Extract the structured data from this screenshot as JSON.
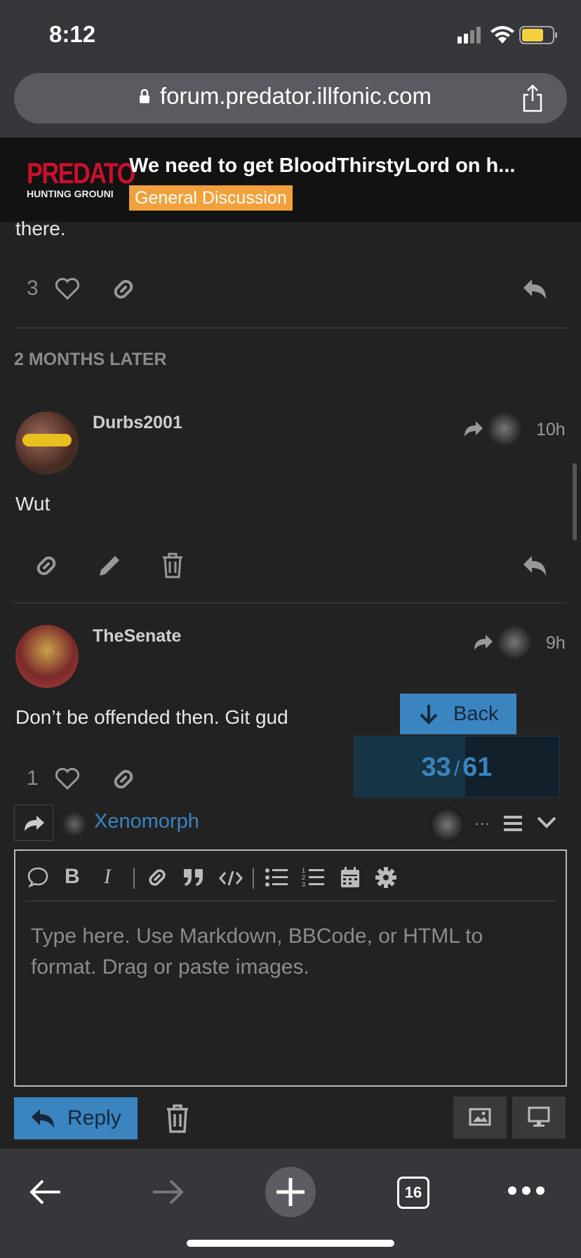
{
  "status_bar": {
    "time": "8:12"
  },
  "browser": {
    "url": "forum.predator.illfonic.com",
    "tab_count": "16"
  },
  "topic_header": {
    "logo_line1": "PREDATO",
    "logo_line2": "HUNTING GROUNI",
    "title": "We need to get BloodThirstyLord on h...",
    "category": "General Discussion",
    "category_color": "#f1a13c"
  },
  "first_post_tail": {
    "text": "there.",
    "like_count": "3"
  },
  "time_gap": {
    "label": "2 MONTHS LATER"
  },
  "posts": [
    {
      "username": "Durbs2001",
      "age": "10h",
      "body": "Wut"
    },
    {
      "username": "TheSenate",
      "age": "9h",
      "body": "Don’t be offended then. Git gud",
      "like_count": "1"
    }
  ],
  "timeline": {
    "back_label": "Back",
    "current": "33",
    "separator": "/",
    "total": "61",
    "progress_fraction": 0.54
  },
  "composer": {
    "reply_to_user": "Xenomorph",
    "ellipsis": "···",
    "placeholder": "Type here. Use Markdown, BBCode, or HTML to format. Drag or paste images.",
    "reply_label": "Reply"
  },
  "colors": {
    "accent": "#3a84c0",
    "background": "#222222",
    "chrome": "#36373b"
  }
}
